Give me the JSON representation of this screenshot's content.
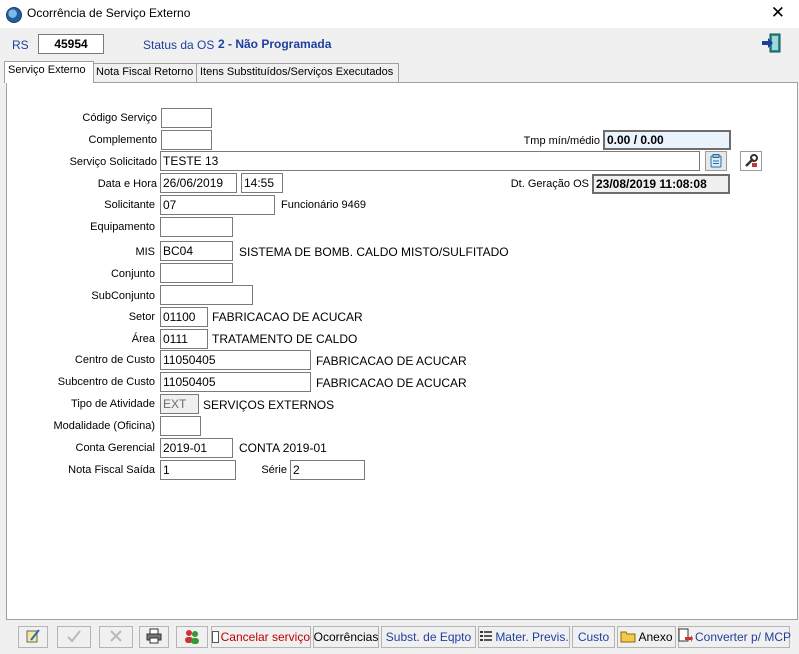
{
  "window": {
    "title": "Ocorrência de Serviço Externo",
    "close_glyph": "✕"
  },
  "header": {
    "rs_label": "RS",
    "rs_value": "45954",
    "status_label": "Status da OS",
    "status_value": "2 - Não Programada"
  },
  "tabs": [
    {
      "label": "Serviço Externo"
    },
    {
      "label": "Nota Fiscal Retorno"
    },
    {
      "label": "Itens Substituídos/Serviços Executados"
    }
  ],
  "form": {
    "codigo_servico": {
      "label": "Código Serviço",
      "value": ""
    },
    "complemento": {
      "label": "Complemento",
      "value": ""
    },
    "tmp": {
      "label": "Tmp mín/médio",
      "value": "0.00 / 0.00"
    },
    "servico_solicitado": {
      "label": "Serviço Solicitado",
      "value": "TESTE 13"
    },
    "data_hora": {
      "label": "Data e Hora",
      "date": "26/06/2019",
      "time": "14:55"
    },
    "dt_geracao": {
      "label": "Dt. Geração OS",
      "value": "23/08/2019 11:08:08"
    },
    "solicitante": {
      "label": "Solicitante",
      "value": "07",
      "desc": "Funcionário 9469"
    },
    "equipamento": {
      "label": "Equipamento",
      "value": ""
    },
    "mis": {
      "label": "MIS",
      "value": "BC04",
      "desc": "SISTEMA DE BOMB. CALDO MISTO/SULFITADO"
    },
    "conjunto": {
      "label": "Conjunto",
      "value": ""
    },
    "subconjunto": {
      "label": "SubConjunto",
      "value": ""
    },
    "setor": {
      "label": "Setor",
      "value": "01100",
      "desc": "FABRICACAO DE ACUCAR"
    },
    "area": {
      "label": "Área",
      "value": "0111",
      "desc": "TRATAMENTO DE CALDO"
    },
    "centro_custo": {
      "label": "Centro de Custo",
      "value": "11050405",
      "desc": "FABRICACAO DE ACUCAR"
    },
    "subcentro_custo": {
      "label": "Subcentro de Custo",
      "value": "11050405",
      "desc": "FABRICACAO DE ACUCAR"
    },
    "tipo_atividade": {
      "label": "Tipo de Atividade",
      "value": "EXT",
      "desc": "SERVIÇOS EXTERNOS"
    },
    "modalidade": {
      "label": "Modalidade (Oficina)",
      "value": ""
    },
    "conta_gerencial": {
      "label": "Conta Gerencial",
      "value": "2019-01",
      "desc": "CONTA 2019-01"
    },
    "nota_fiscal_saida": {
      "label": "Nota Fiscal Saída",
      "value": "1"
    },
    "serie": {
      "label": "Série",
      "value": "2"
    }
  },
  "toolbar": {
    "cancelar_label": "Cancelar serviço",
    "ocorrencias_label": "Ocorrências",
    "subst_label": "Subst. de Eqpto",
    "mater_label": "Mater. Previs.",
    "custo_label": "Custo",
    "anexo_label": "Anexo",
    "converter_label": "Converter p/ MCP"
  },
  "colors": {
    "accent_blue": "#1f3f9f",
    "cancel_red": "#c00000"
  }
}
